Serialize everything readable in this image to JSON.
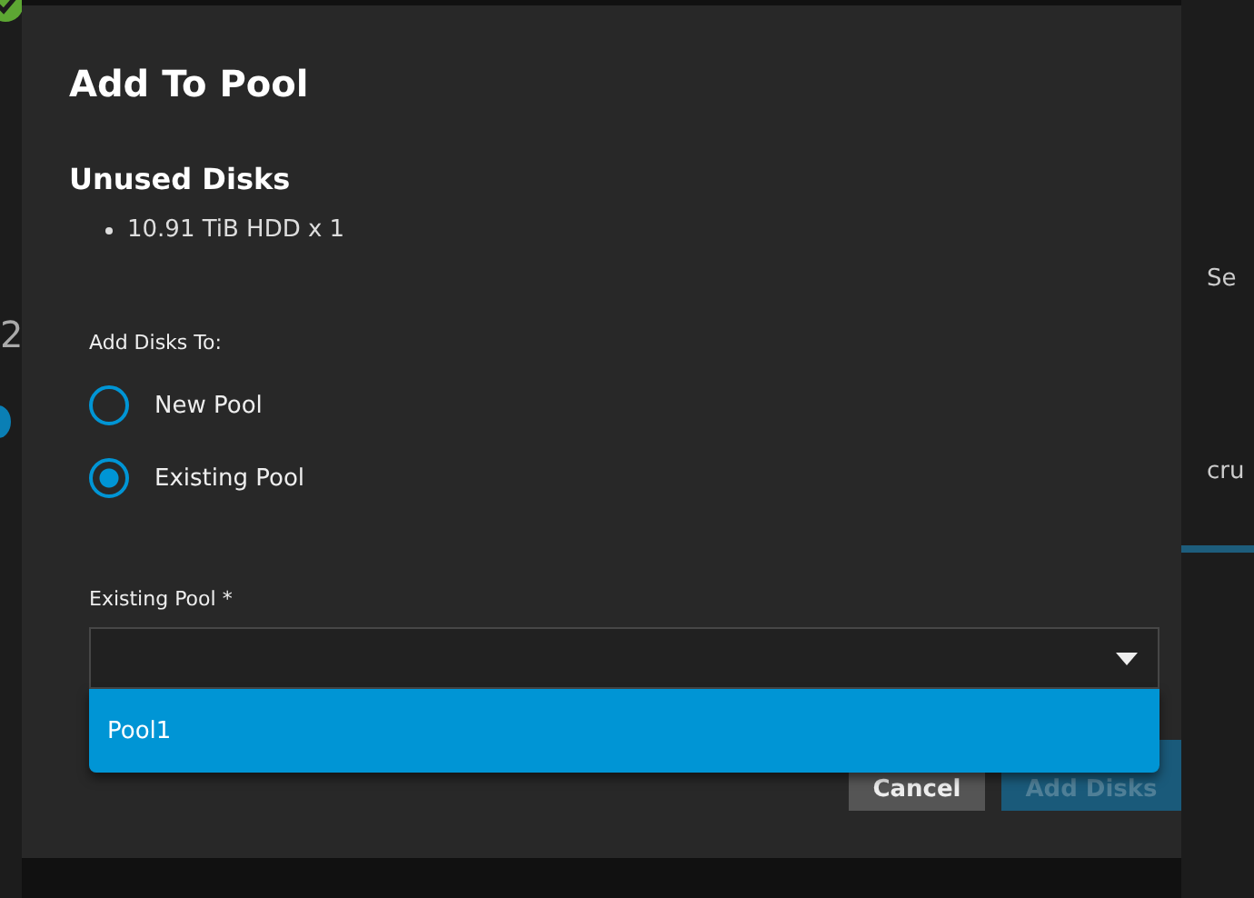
{
  "background": {
    "left_text": "2",
    "right_texts": [
      "Se",
      "cru"
    ]
  },
  "dialog": {
    "title": "Add To Pool",
    "unused_disks": {
      "heading": "Unused Disks",
      "items": [
        "10.91 TiB HDD x 1"
      ]
    },
    "add_to": {
      "label": "Add Disks To:",
      "options": [
        {
          "label": "New Pool",
          "selected": false
        },
        {
          "label": "Existing Pool",
          "selected": true
        }
      ]
    },
    "pool_field": {
      "label": "Existing Pool *",
      "options": [
        {
          "label": "Pool1",
          "selected": true
        }
      ]
    },
    "buttons": [
      {
        "label": "Cancel",
        "kind": "secondary",
        "disabled": false
      },
      {
        "label": "Add Disks",
        "kind": "primary",
        "disabled": true
      }
    ]
  }
}
